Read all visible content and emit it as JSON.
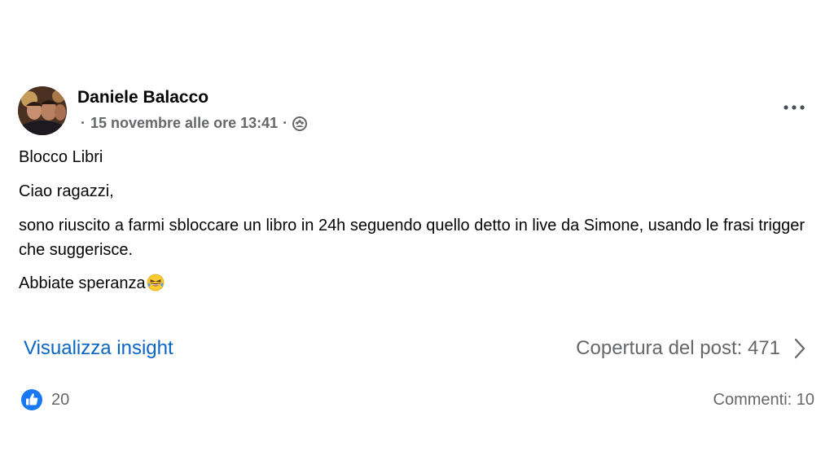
{
  "post": {
    "author_name": "Daniele Balacco",
    "meta_prefix": "·",
    "timestamp": "15 novembre alle ore 13:41",
    "meta_separator": "·",
    "audience_icon": "group-icon",
    "more_icon": "more-options-icon",
    "paragraphs": [
      "Blocco Libri",
      "Ciao ragazzi,",
      "sono riuscito a farmi sbloccare un libro in 24h seguendo quello detto in live da Simone, usando le frasi trigger che suggerisce.",
      "Abbiate speranza"
    ],
    "last_paragraph_emoji": "face-with-tears-of-joy"
  },
  "insights": {
    "link_label": "Visualizza insight",
    "reach_label": "Copertura del post: 471",
    "chevron_icon": "chevron-right-icon"
  },
  "footer": {
    "like_icon": "like-reaction-icon",
    "like_count": "20",
    "comments_label": "Commenti: 10"
  },
  "colors": {
    "link_blue": "#0a66c2",
    "like_blue": "#1877f2",
    "secondary_text": "#65676b",
    "primary_text": "#050505"
  }
}
